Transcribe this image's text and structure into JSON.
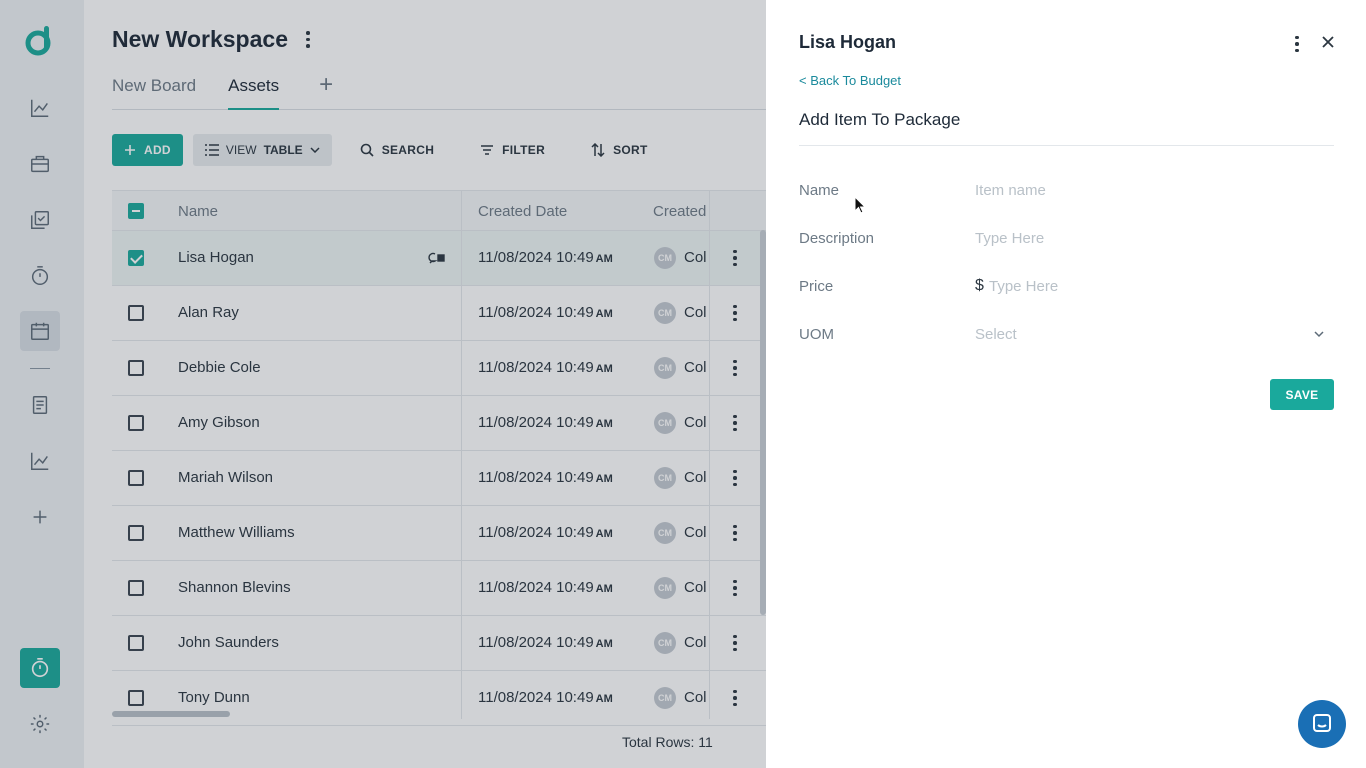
{
  "workspace": {
    "title": "New Workspace"
  },
  "tabs": [
    {
      "label": "New Board"
    },
    {
      "label": "Assets"
    }
  ],
  "tab_add": "+",
  "toolbar": {
    "add": "ADD",
    "view_prefix": "VIEW",
    "view_value": "TABLE",
    "search": "SEARCH",
    "filter": "FILTER",
    "sort": "SORT"
  },
  "table": {
    "columns": [
      "Name",
      "Created Date",
      "Created"
    ],
    "rows": [
      {
        "name": "Lisa Hogan",
        "date": "11/08/2024 10:49",
        "ampm": "AM",
        "initials": "CM",
        "by": "Col",
        "selected": true
      },
      {
        "name": "Alan Ray",
        "date": "11/08/2024 10:49",
        "ampm": "AM",
        "initials": "CM",
        "by": "Col"
      },
      {
        "name": "Debbie Cole",
        "date": "11/08/2024 10:49",
        "ampm": "AM",
        "initials": "CM",
        "by": "Col"
      },
      {
        "name": "Amy Gibson",
        "date": "11/08/2024 10:49",
        "ampm": "AM",
        "initials": "CM",
        "by": "Col"
      },
      {
        "name": "Mariah Wilson",
        "date": "11/08/2024 10:49",
        "ampm": "AM",
        "initials": "CM",
        "by": "Col"
      },
      {
        "name": "Matthew Williams",
        "date": "11/08/2024 10:49",
        "ampm": "AM",
        "initials": "CM",
        "by": "Col"
      },
      {
        "name": "Shannon Blevins",
        "date": "11/08/2024 10:49",
        "ampm": "AM",
        "initials": "CM",
        "by": "Col"
      },
      {
        "name": "John Saunders",
        "date": "11/08/2024 10:49",
        "ampm": "AM",
        "initials": "CM",
        "by": "Col"
      },
      {
        "name": "Tony Dunn",
        "date": "11/08/2024 10:49",
        "ampm": "AM",
        "initials": "CM",
        "by": "Col"
      }
    ],
    "total": "Total Rows: 11"
  },
  "panel": {
    "title": "Lisa Hogan",
    "back": "< Back To Budget",
    "subtitle": "Add Item To Package",
    "fields": {
      "name_label": "Name",
      "name_placeholder": "Item name",
      "desc_label": "Description",
      "desc_placeholder": "Type Here",
      "price_label": "Price",
      "currency": "$",
      "price_placeholder": "Type Here",
      "uom_label": "UOM",
      "uom_placeholder": "Select"
    },
    "save": "SAVE"
  },
  "colors": {
    "accent": "#1aa99c",
    "link": "#1a8a9c",
    "chat": "#1a6fb5"
  }
}
